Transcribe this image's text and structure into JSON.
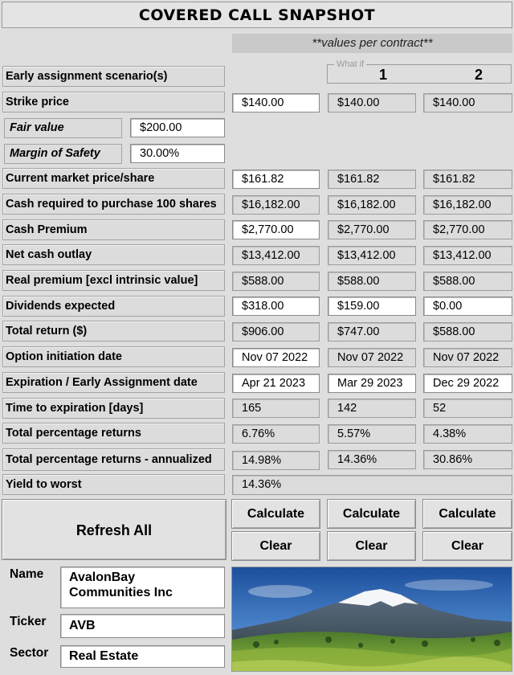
{
  "title": "COVERED CALL SNAPSHOT",
  "values_note": "**values per contract**",
  "what_if_label": "What if",
  "scenarios": [
    "1",
    "2"
  ],
  "fair_value": {
    "label": "Fair value",
    "value": "$200.00"
  },
  "margin_of_safety": {
    "label": "Margin of Safety",
    "value": "30.00%"
  },
  "rows": {
    "early_assignment": {
      "label": "Early assignment scenario(s)"
    },
    "strike": {
      "label": "Strike price",
      "values": [
        "$140.00",
        "$140.00",
        "$140.00"
      ]
    },
    "current_price": {
      "label": "Current market price/share",
      "values": [
        "$161.82",
        "$161.82",
        "$161.82"
      ]
    },
    "cash_required": {
      "label": "Cash required to purchase 100 shares",
      "values": [
        "$16,182.00",
        "$16,182.00",
        "$16,182.00"
      ]
    },
    "cash_premium": {
      "label": "Cash Premium",
      "values": [
        "$2,770.00",
        "$2,770.00",
        "$2,770.00"
      ]
    },
    "net_outlay": {
      "label": "Net cash outlay",
      "values": [
        "$13,412.00",
        "$13,412.00",
        "$13,412.00"
      ]
    },
    "real_premium": {
      "label": "Real premium [excl intrinsic value]",
      "values": [
        "$588.00",
        "$588.00",
        "$588.00"
      ]
    },
    "dividends": {
      "label": "Dividends expected",
      "values": [
        "$318.00",
        "$159.00",
        "$0.00"
      ]
    },
    "total_return": {
      "label": "Total return ($)",
      "values": [
        "$906.00",
        "$747.00",
        "$588.00"
      ]
    },
    "initiation_date": {
      "label": "Option initiation date",
      "values": [
        "Nov 07 2022",
        "Nov 07 2022",
        "Nov 07 2022"
      ]
    },
    "expiration_date": {
      "label": "Expiration / Early Assignment date",
      "values": [
        "Apr 21 2023",
        "Mar 29 2023",
        "Dec 29 2022"
      ]
    },
    "time_to_exp": {
      "label": "Time to expiration [days]",
      "values": [
        "165",
        "142",
        "52"
      ]
    },
    "total_pct": {
      "label": "Total percentage returns",
      "values": [
        "6.76%",
        "5.57%",
        "4.38%"
      ]
    },
    "total_pct_ann": {
      "label": "Total percentage returns - annualized",
      "values": [
        "14.98%",
        "14.36%",
        "30.86%"
      ]
    },
    "yield_to_worst": {
      "label": "Yield to worst",
      "value": "14.36%"
    }
  },
  "buttons": {
    "refresh_all": "Refresh All",
    "calculate": "Calculate",
    "clear": "Clear"
  },
  "company": {
    "name_label": "Name",
    "name": "AvalonBay Communities Inc",
    "ticker_label": "Ticker",
    "ticker": "AVB",
    "sector_label": "Sector",
    "sector": "Real Estate"
  },
  "icons": {
    "photo": "mountain-landscape-photo"
  }
}
